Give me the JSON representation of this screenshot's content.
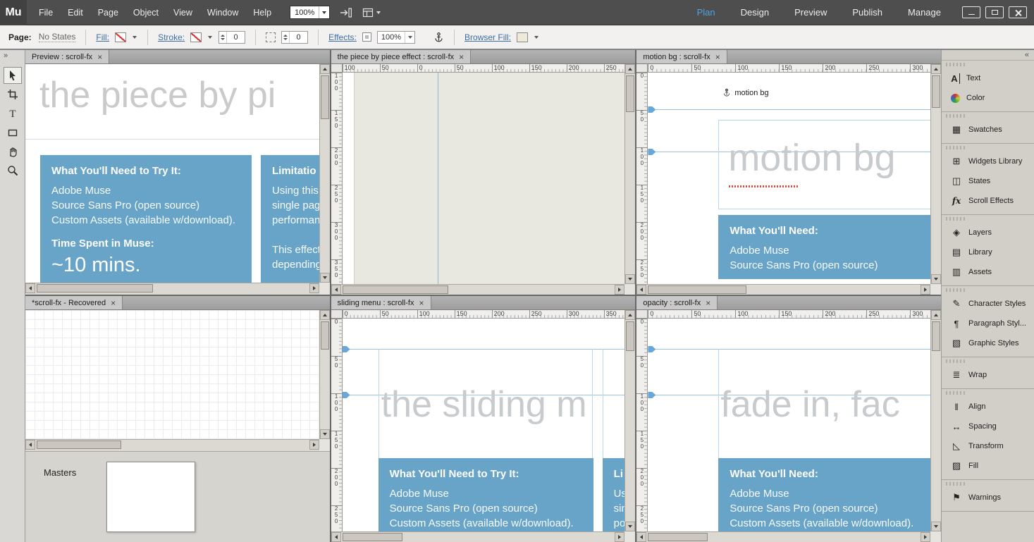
{
  "menubar": {
    "logo": "Mu",
    "menus": [
      "File",
      "Edit",
      "Page",
      "Object",
      "View",
      "Window",
      "Help"
    ],
    "zoom_value": "100%",
    "modes": [
      "Plan",
      "Design",
      "Preview",
      "Publish",
      "Manage"
    ],
    "active_mode": "Design"
  },
  "controlbar": {
    "page_label": "Page:",
    "page_value": "No States",
    "fill_label": "Fill:",
    "stroke_label": "Stroke:",
    "stroke_weight": "0",
    "corner_value": "0",
    "effects_label": "Effects:",
    "effects_value": "100%",
    "browser_fill_label": "Browser Fill:"
  },
  "ui": {
    "tab_close": "×",
    "collapse_dock": "«",
    "expand_tools": "»"
  },
  "colors": {
    "accent_blue": "#68a4c8",
    "guide_blue": "#69a7d8",
    "link_blue": "#3b6fa5",
    "active_mode_blue": "#4fa3e0"
  },
  "documents": {
    "preview": {
      "tab": "Preview : scroll-fx",
      "heading": "the piece by pi",
      "box1_title": "What You'll Need to Try It:",
      "box1_lines": [
        "Adobe Muse",
        "Source Sans Pro (open source)",
        "Custom Assets (available w/download)."
      ],
      "box1_subtitle": "Time Spent in Muse:",
      "box1_big": "~10 mins.",
      "box2_title": "Limitatio",
      "box2_lines": [
        "Using this",
        "single pag",
        "performan",
        "",
        "This effect",
        "depending"
      ]
    },
    "piece": {
      "tab": "the piece by piece effect : scroll-fx",
      "hruler": [
        "100",
        "50",
        "0",
        "50",
        "100",
        "150",
        "200",
        "250"
      ],
      "vruler": [
        "100",
        "150",
        "200",
        "250",
        "300",
        "350"
      ]
    },
    "motionbg": {
      "tab": "motion bg : scroll-fx",
      "anchor_label": "motion bg",
      "heading": "motion bg",
      "box_title": "What You'll Need:",
      "box_lines": [
        "Adobe Muse",
        "Source Sans Pro (open source)"
      ],
      "hruler": [
        "0",
        "50",
        "100",
        "150",
        "200",
        "250",
        "300"
      ],
      "vruler": [
        "0",
        "50",
        "100",
        "150",
        "200",
        "250"
      ]
    },
    "recovered": {
      "tab": "*scroll-fx - Recovered",
      "masters_label": "Masters"
    },
    "sliding": {
      "tab": "sliding menu : scroll-fx",
      "heading": "the sliding m",
      "box1_title": "What You'll Need to Try It:",
      "box1_lines": [
        "Adobe Muse",
        "Source Sans Pro (open source)",
        "Custom Assets (available w/download)."
      ],
      "box2_title": "Li",
      "box2_lines": [
        "Us",
        "sin",
        "po"
      ],
      "hruler": [
        "0",
        "50",
        "100",
        "150",
        "200",
        "250",
        "300",
        "350"
      ],
      "vruler": [
        "0",
        "50",
        "100",
        "150",
        "200",
        "250"
      ]
    },
    "opacity": {
      "tab": "opacity : scroll-fx",
      "heading": "fade in, fac",
      "box_title": "What You'll Need:",
      "box_lines": [
        "Adobe Muse",
        "Source Sans Pro (open source)",
        "Custom Assets (available w/download)."
      ],
      "hruler": [
        "0",
        "50",
        "100",
        "150",
        "200",
        "250",
        "300"
      ],
      "vruler": [
        "0",
        "50",
        "100",
        "150",
        "200",
        "250"
      ]
    }
  },
  "dock": {
    "g1": [
      {
        "label": "Text",
        "glyph": "A",
        "icon": "text-icon"
      },
      {
        "label": "Color",
        "glyph": "●",
        "icon": "color-icon"
      }
    ],
    "g2": [
      {
        "label": "Swatches",
        "glyph": "▦",
        "icon": "swatches-icon"
      }
    ],
    "g3": [
      {
        "label": "Widgets Library",
        "glyph": "⊞",
        "icon": "widgets-library-icon"
      },
      {
        "label": "States",
        "glyph": "◫",
        "icon": "states-icon"
      },
      {
        "label": "Scroll Effects",
        "glyph": "fx",
        "icon": "scroll-effects-icon"
      }
    ],
    "g4": [
      {
        "label": "Layers",
        "glyph": "◈",
        "icon": "layers-icon"
      },
      {
        "label": "Library",
        "glyph": "▤",
        "icon": "library-icon"
      },
      {
        "label": "Assets",
        "glyph": "▥",
        "icon": "assets-icon"
      }
    ],
    "g5": [
      {
        "label": "Character Styles",
        "glyph": "✎",
        "icon": "character-styles-icon"
      },
      {
        "label": "Paragraph Styl...",
        "glyph": "¶",
        "icon": "paragraph-styles-icon"
      },
      {
        "label": "Graphic Styles",
        "glyph": "▧",
        "icon": "graphic-styles-icon"
      }
    ],
    "g6": [
      {
        "label": "Wrap",
        "glyph": "≣",
        "icon": "wrap-icon"
      }
    ],
    "g7": [
      {
        "label": "Align",
        "glyph": "‖",
        "icon": "align-icon"
      },
      {
        "label": "Spacing",
        "glyph": "↔",
        "icon": "spacing-icon"
      },
      {
        "label": "Transform",
        "glyph": "◺",
        "icon": "transform-icon"
      },
      {
        "label": "Fill",
        "glyph": "▨",
        "icon": "fill-icon"
      }
    ],
    "g8": [
      {
        "label": "Warnings",
        "glyph": "⚑",
        "icon": "warnings-icon"
      }
    ]
  }
}
